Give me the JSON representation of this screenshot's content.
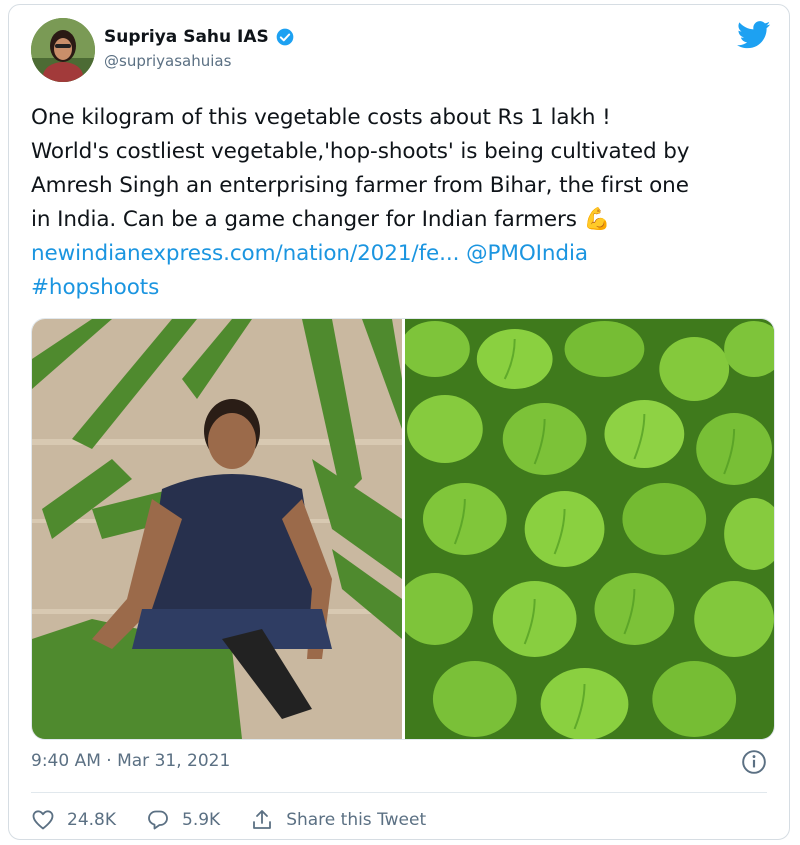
{
  "author": {
    "display_name": "Supriya Sahu IAS",
    "handle": "@supriyasahuias",
    "verified": true
  },
  "tweet": {
    "line1": "One kilogram of this vegetable costs about Rs 1 lakh !",
    "line2": "World's costliest vegetable,'hop-shoots' is being cultivated by",
    "line3": "Amresh Singh an enterprising farmer from Bihar, the first one",
    "line4": "in India. Can be a game changer for Indian farmers ",
    "emoji": "💪",
    "link": "newindianexpress.com/nation/2021/fe...",
    "mention": "@PMOIndia",
    "hashtag": "#hopshoots"
  },
  "timestamp": "9:40 AM · Mar 31, 2021",
  "actions": {
    "likes": "24.8K",
    "replies": "5.9K",
    "share_label": "Share this Tweet"
  },
  "colors": {
    "link": "#1b95e0",
    "twitter_blue": "#1da1f2",
    "secondary_text": "#5b7083"
  },
  "icons": {
    "logo": "twitter-bird-icon",
    "verified": "verified-badge-icon",
    "info": "info-icon",
    "like": "heart-icon",
    "reply": "reply-bubble-icon",
    "share": "share-icon"
  }
}
